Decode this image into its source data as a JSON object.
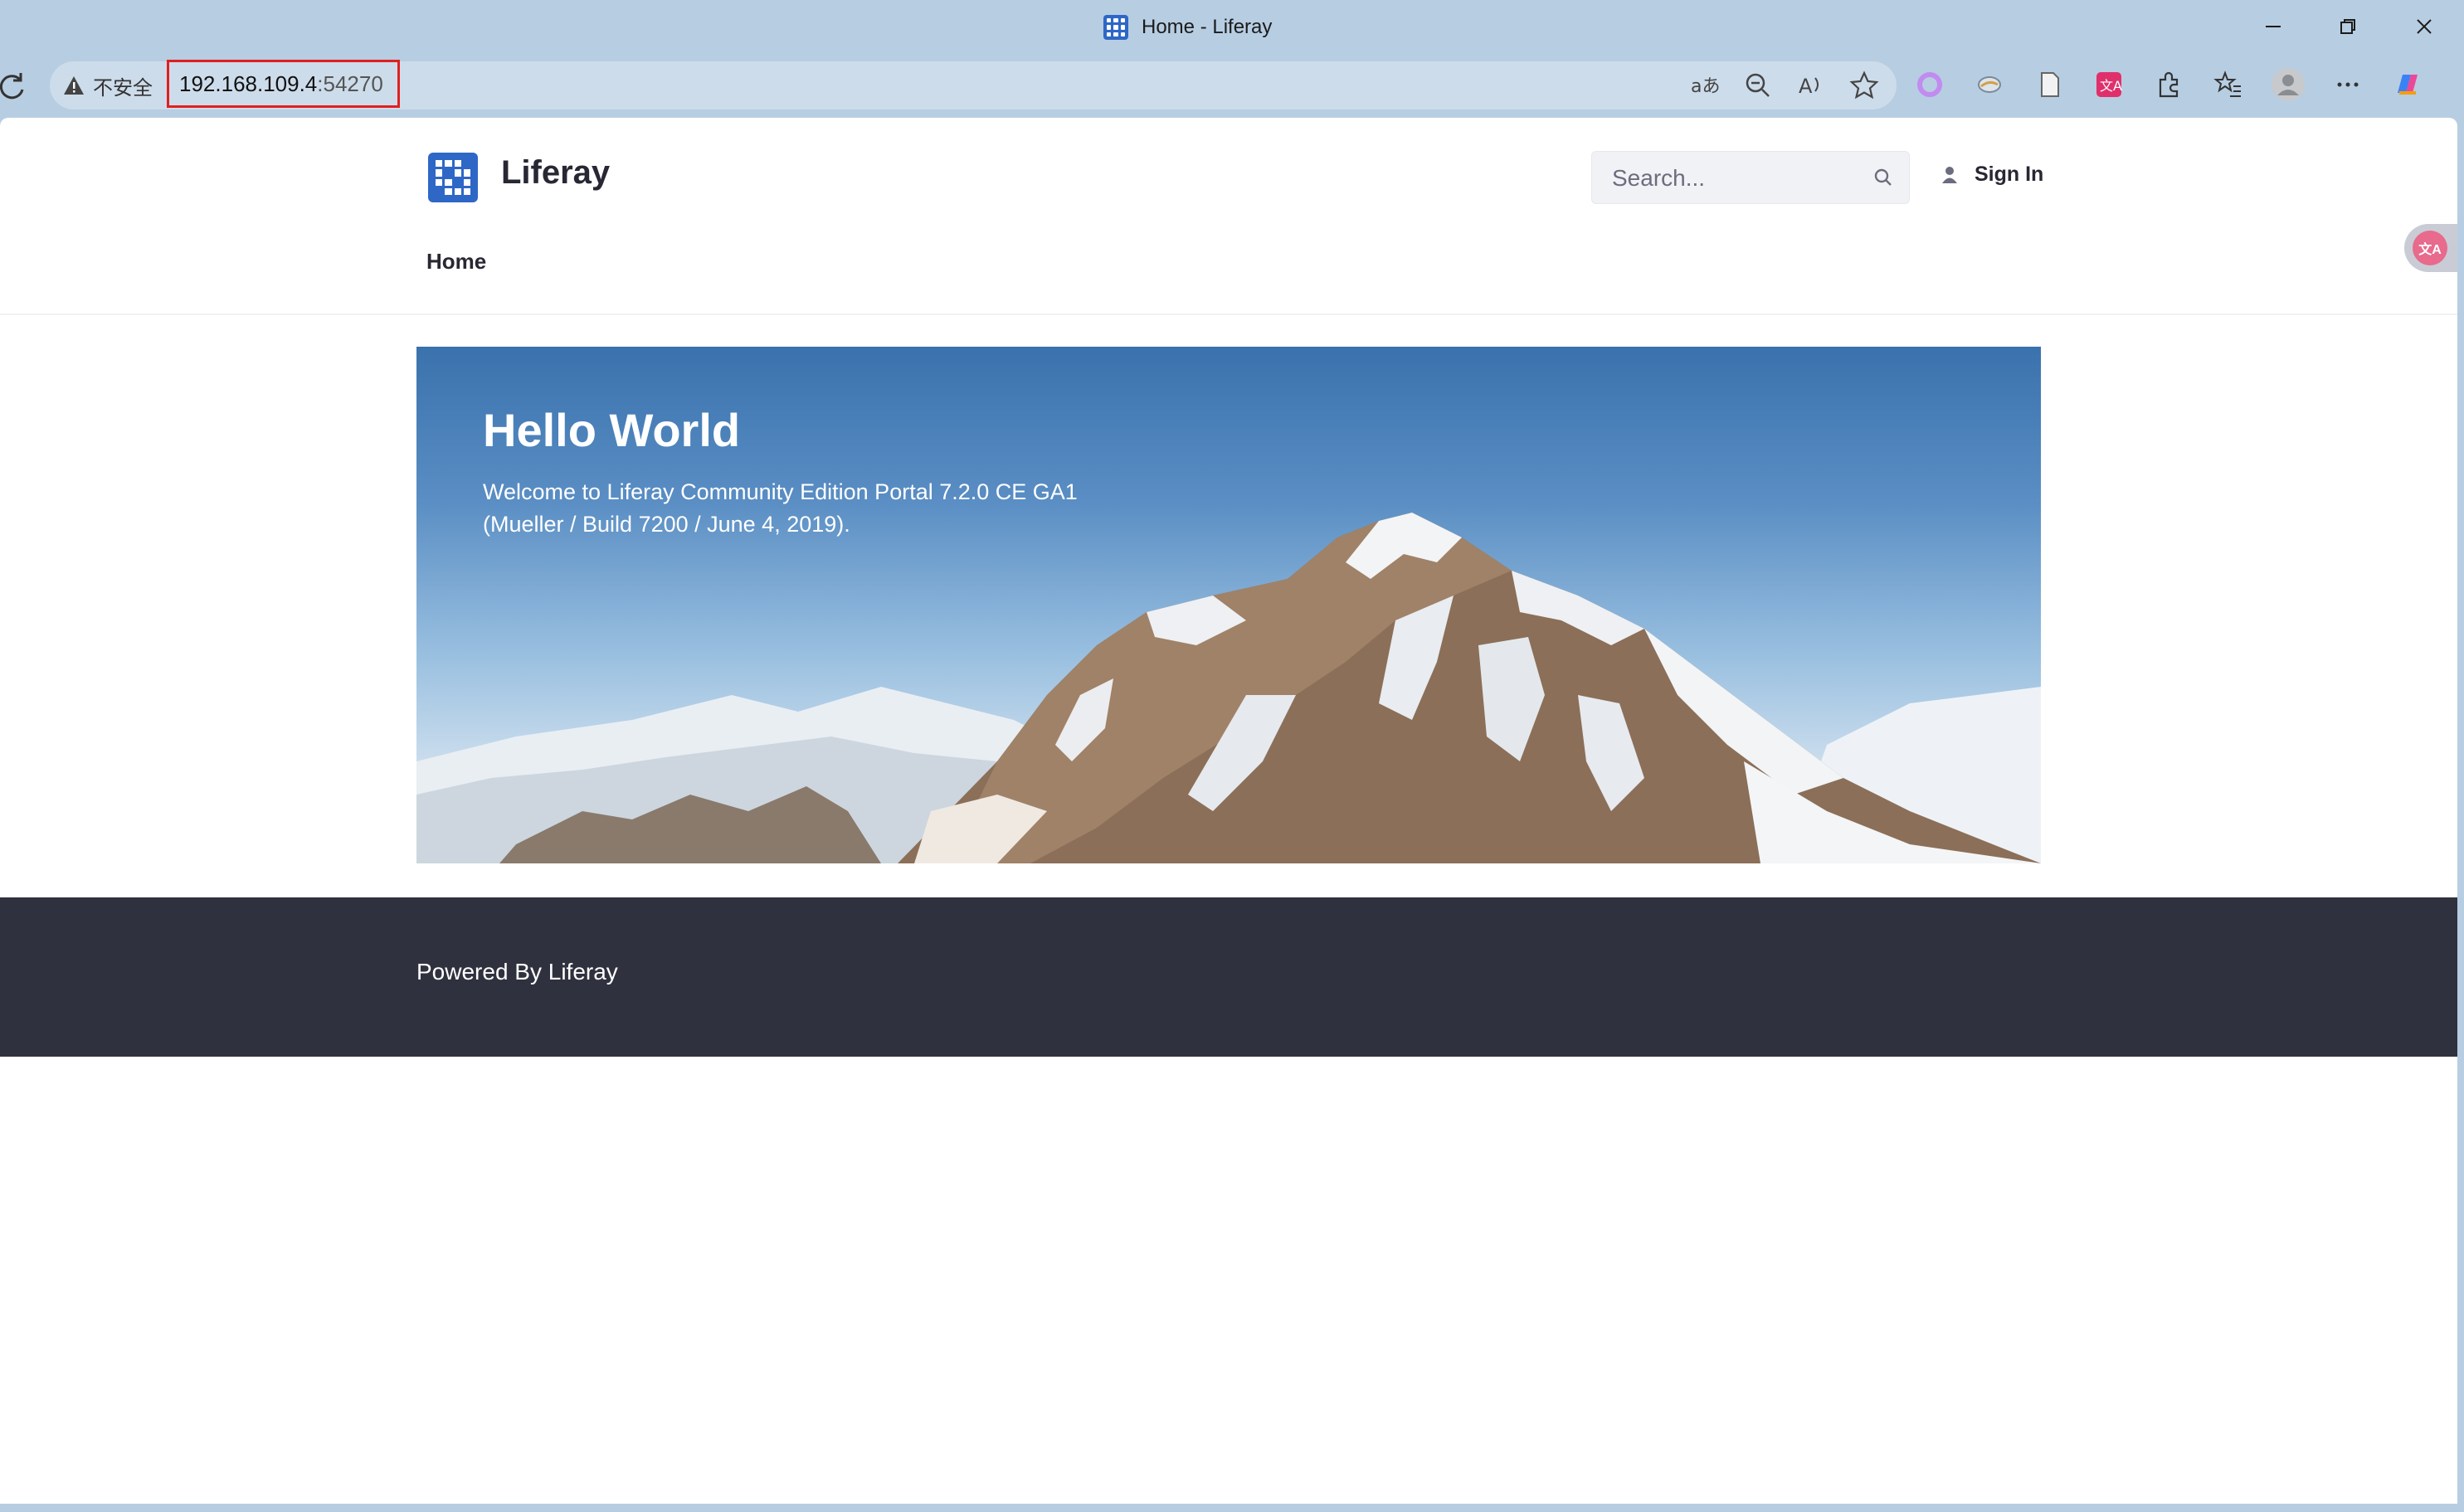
{
  "browser": {
    "tab_title": "Home - Liferay",
    "security_label": "不安全",
    "url_host": "192.168.109.4",
    "url_port": ":54270"
  },
  "site": {
    "name": "Liferay",
    "search_placeholder": "Search...",
    "signin_label": "Sign In",
    "nav": [
      {
        "label": "Home"
      }
    ]
  },
  "hero": {
    "title": "Hello World",
    "line1": "Welcome to Liferay Community Edition Portal 7.2.0 CE GA1",
    "line2": "(Mueller / Build 7200 / June 4, 2019)."
  },
  "footer": {
    "text": "Powered By Liferay"
  },
  "colors": {
    "brand": "#2e67c6",
    "footer_bg": "#30313f",
    "url_highlight": "#e0201f"
  }
}
